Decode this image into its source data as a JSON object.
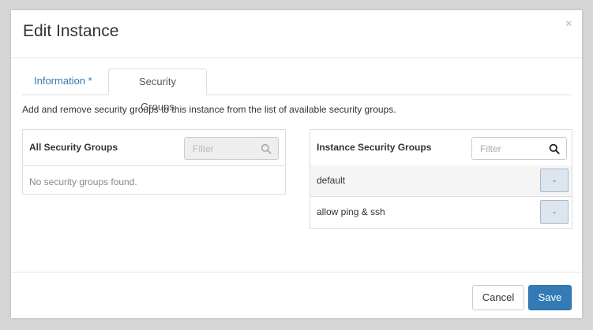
{
  "modal": {
    "title": "Edit Instance",
    "close_label": "×"
  },
  "tabs": [
    {
      "label": "Information *",
      "active": false
    },
    {
      "label": "Security Groups",
      "active": true
    }
  ],
  "help_text": "Add and remove security groups to this instance from the list of available security groups.",
  "available_panel": {
    "title": "All Security Groups",
    "filter_placeholder": "Filter",
    "empty_message": "No security groups found."
  },
  "allocated_panel": {
    "title": "Instance Security Groups",
    "filter_placeholder": "Filter",
    "items": [
      {
        "name": "default",
        "remove_label": "-"
      },
      {
        "name": "allow ping & ssh",
        "remove_label": "-"
      }
    ]
  },
  "footer": {
    "cancel_label": "Cancel",
    "save_label": "Save"
  },
  "colors": {
    "accent": "#337ab7",
    "link": "#337ab7",
    "remove_button_bg": "#dde5ee"
  }
}
